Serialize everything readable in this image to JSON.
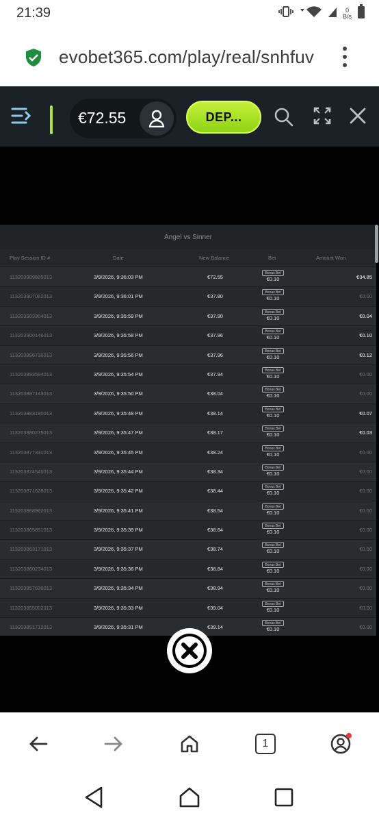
{
  "status_bar": {
    "time": "21:39",
    "net_speed_value": "0",
    "net_speed_unit": "B/s"
  },
  "browser": {
    "url": "evobet365.com/play/real/snhfuv"
  },
  "header": {
    "balance": "€72.55",
    "deposit_label": "DEP..."
  },
  "table": {
    "title": "Angel vs Sinner",
    "columns": [
      "Play Session ID #",
      "Date",
      "New Balance",
      "Bet",
      "Amount Won"
    ],
    "bonus_tag": "Bonus Bet",
    "rows": [
      {
        "id": "113203909605013",
        "date": "3/9/2026, 9:36:03 PM",
        "balance": "€72.55",
        "bet": "€0.10",
        "won": "€34.85",
        "zero": false
      },
      {
        "id": "113203907082013",
        "date": "3/9/2026, 9:36:01 PM",
        "balance": "€37.80",
        "bet": "€0.10",
        "won": "€0.00",
        "zero": true
      },
      {
        "id": "113203903304013",
        "date": "3/9/2026, 9:35:59 PM",
        "balance": "€37.90",
        "bet": "€0.10",
        "won": "€0.04",
        "zero": false
      },
      {
        "id": "113203900146013",
        "date": "3/9/2026, 9:35:58 PM",
        "balance": "€37.96",
        "bet": "€0.10",
        "won": "€0.10",
        "zero": false
      },
      {
        "id": "113203896736013",
        "date": "3/9/2026, 9:35:56 PM",
        "balance": "€37.96",
        "bet": "€0.10",
        "won": "€0.12",
        "zero": false
      },
      {
        "id": "113203893594013",
        "date": "3/9/2026, 9:35:54 PM",
        "balance": "€37.94",
        "bet": "€0.10",
        "won": "€0.00",
        "zero": true
      },
      {
        "id": "113203887143013",
        "date": "3/9/2026, 9:35:50 PM",
        "balance": "€38.04",
        "bet": "€0.10",
        "won": "€0.00",
        "zero": true
      },
      {
        "id": "113203883190013",
        "date": "3/9/2026, 9:35:48 PM",
        "balance": "€38.14",
        "bet": "€0.10",
        "won": "€0.07",
        "zero": false
      },
      {
        "id": "113203880275013",
        "date": "3/9/2026, 9:35:47 PM",
        "balance": "€38.17",
        "bet": "€0.10",
        "won": "€0.03",
        "zero": false
      },
      {
        "id": "113203877331013",
        "date": "3/9/2026, 9:35:45 PM",
        "balance": "€38.24",
        "bet": "€0.10",
        "won": "€0.00",
        "zero": true
      },
      {
        "id": "113203874545013",
        "date": "3/9/2026, 9:35:44 PM",
        "balance": "€38.34",
        "bet": "€0.10",
        "won": "€0.00",
        "zero": true
      },
      {
        "id": "113203871628013",
        "date": "3/9/2026, 9:35:42 PM",
        "balance": "€38.44",
        "bet": "€0.10",
        "won": "€0.00",
        "zero": true
      },
      {
        "id": "113203868962013",
        "date": "3/9/2026, 9:35:41 PM",
        "balance": "€38.54",
        "bet": "€0.10",
        "won": "€0.00",
        "zero": true
      },
      {
        "id": "113203865851013",
        "date": "3/9/2026, 9:35:39 PM",
        "balance": "€38.64",
        "bet": "€0.10",
        "won": "€0.00",
        "zero": true
      },
      {
        "id": "113203863171013",
        "date": "3/9/2026, 9:35:37 PM",
        "balance": "€38.74",
        "bet": "€0.10",
        "won": "€0.00",
        "zero": true
      },
      {
        "id": "113203860234013",
        "date": "3/9/2026, 9:35:36 PM",
        "balance": "€38.84",
        "bet": "€0.10",
        "won": "€0.00",
        "zero": true
      },
      {
        "id": "113203857636013",
        "date": "3/9/2026, 9:35:34 PM",
        "balance": "€38.94",
        "bet": "€0.10",
        "won": "€0.00",
        "zero": true
      },
      {
        "id": "113203855002013",
        "date": "3/9/2026, 9:35:33 PM",
        "balance": "€39.04",
        "bet": "€0.10",
        "won": "€0.00",
        "zero": true
      },
      {
        "id": "113203851712013",
        "date": "3/9/2026, 9:35:31 PM",
        "balance": "€39.14",
        "bet": "€0.10",
        "won": "€0.00",
        "zero": true
      }
    ]
  },
  "bottom_nav": {
    "tab_count": "1"
  },
  "icons": [
    "vibrate-icon",
    "wifi-icon",
    "signal-icon",
    "battery-icon",
    "shield-check-icon",
    "more-vert-icon",
    "menu-collapse-icon",
    "user-icon",
    "search-icon",
    "fullscreen-icon",
    "close-icon",
    "back-arrow-icon",
    "forward-arrow-icon",
    "home-icon",
    "tabs-icon",
    "account-icon"
  ],
  "colors": {
    "accent": "#aee43c",
    "header_bg": "#1b2227",
    "shield_green": "#1e8e3e",
    "notification_dot": "#e53935"
  }
}
